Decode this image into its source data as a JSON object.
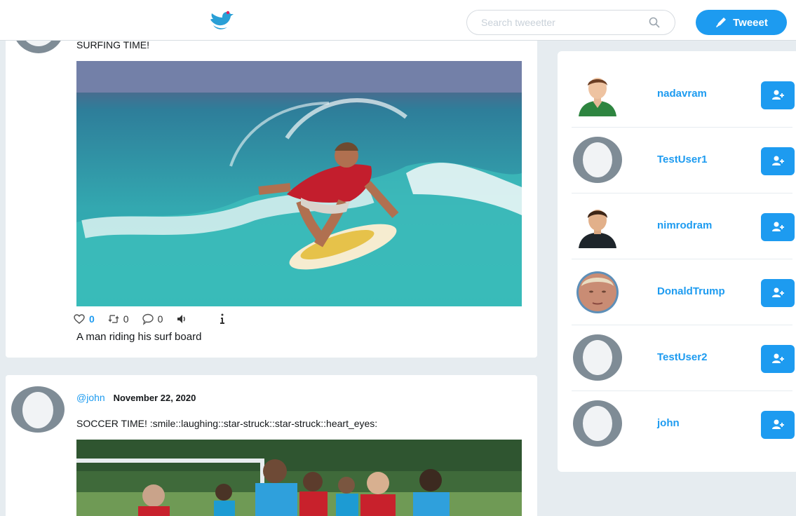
{
  "header": {
    "search_placeholder": "Search tweeetter",
    "tweet_button": "Tweeet"
  },
  "posts": [
    {
      "text": "SURFING TIME!",
      "image": "surfer-riding-wave",
      "likes": "0",
      "retweets": "0",
      "comments": "0",
      "caption": "A man riding his surf board"
    },
    {
      "handle": "@john",
      "date": "November 22, 2020",
      "text": "SOCCER TIME! :smile::laughing::star-struck::star-struck::heart_eyes:",
      "image": "kids-playing-soccer"
    }
  ],
  "suggestions": [
    {
      "name": "nadavram",
      "avatar": "man-green-shirt"
    },
    {
      "name": "TestUser1",
      "avatar": "default-egg"
    },
    {
      "name": "nimrodram",
      "avatar": "man-black-shirt"
    },
    {
      "name": "DonaldTrump",
      "avatar": "photo"
    },
    {
      "name": "TestUser2",
      "avatar": "default-egg"
    },
    {
      "name": "john",
      "avatar": "default-egg"
    }
  ],
  "colors": {
    "accent": "#1d9bf0",
    "background": "#e6ecf0"
  }
}
